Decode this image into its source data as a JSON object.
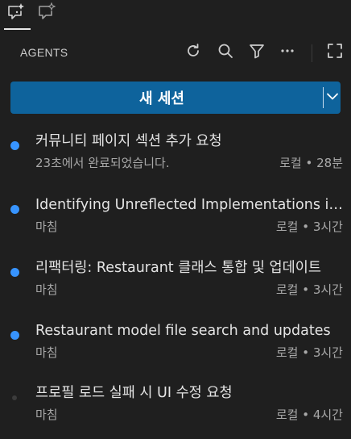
{
  "tabs": [
    {
      "icon": "chat-sparkle-icon",
      "active": true
    },
    {
      "icon": "chat-sparkle-outline-icon",
      "active": false
    }
  ],
  "header": {
    "title": "AGENTS",
    "actions": [
      "refresh-icon",
      "search-icon",
      "filter-icon",
      "more-icon",
      "maximize-icon"
    ]
  },
  "new_session": {
    "label": "새 세션",
    "color": "#0e639c"
  },
  "sessions": [
    {
      "title": "커뮤니티 페이지 섹션 추가 요청",
      "status": "23초에서 완료되었습니다.",
      "location": "로컬",
      "time": "28분",
      "unread": true
    },
    {
      "title": "Identifying Unreflected Implementations in Code",
      "status": "마침",
      "location": "로컬",
      "time": "3시간",
      "unread": true
    },
    {
      "title": "리팩터링: Restaurant 클래스 통합 및 업데이트",
      "status": "마침",
      "location": "로컬",
      "time": "3시간",
      "unread": true
    },
    {
      "title": "Restaurant model file search and updates",
      "status": "마침",
      "location": "로컬",
      "time": "3시간",
      "unread": true
    },
    {
      "title": "프로필 로드 실패 시 UI 수정 요청",
      "status": "마침",
      "location": "로컬",
      "time": "4시간",
      "unread": false
    }
  ],
  "colors": {
    "accent_dot": "#3794ff",
    "background": "#1f1f1f"
  }
}
